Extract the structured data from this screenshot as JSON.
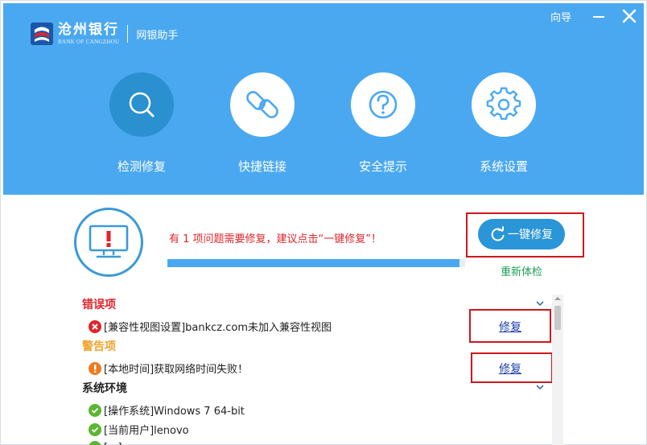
{
  "app": {
    "bank_name_cn": "沧州银行",
    "bank_name_en": "BANK OF CANGZHOU",
    "module_name": "网银助手"
  },
  "titlebar": {
    "guide_label": "向导"
  },
  "nav": {
    "items": [
      {
        "label": "检测修复",
        "icon": "search-icon",
        "active": true
      },
      {
        "label": "快捷链接",
        "icon": "link-icon",
        "active": false
      },
      {
        "label": "安全提示",
        "icon": "question-icon",
        "active": false
      },
      {
        "label": "系统设置",
        "icon": "gear-icon",
        "active": false
      }
    ]
  },
  "status": {
    "message": "有 1 项问题需要修复，建议点击“一键修复”！",
    "progress_fraction": 0.98,
    "fix_all_label": "一键修复",
    "recheck_label": "重新体检"
  },
  "sections": {
    "error_title": "错误项",
    "warning_title": "警告项",
    "env_title": "系统环境"
  },
  "items": {
    "error_1": "[兼容性视图设置]bankcz.com未加入兼容性视图",
    "warning_1": "[本地时间]获取网络时间失败！",
    "env_1": "[操作系统]Windows 7 64-bit",
    "env_2": "[当前用户]lenovo",
    "env_3": "[...]"
  },
  "actions": {
    "fix_label": "修复"
  },
  "colors": {
    "header_blue": "#4aa8f0",
    "active_blue": "#2a90cf",
    "error_red": "#e0242a",
    "warning_orange": "#f0a22a",
    "ok_green": "#5cb531",
    "link_blue": "#1a3fa6",
    "recheck_green": "#1b9e52"
  }
}
